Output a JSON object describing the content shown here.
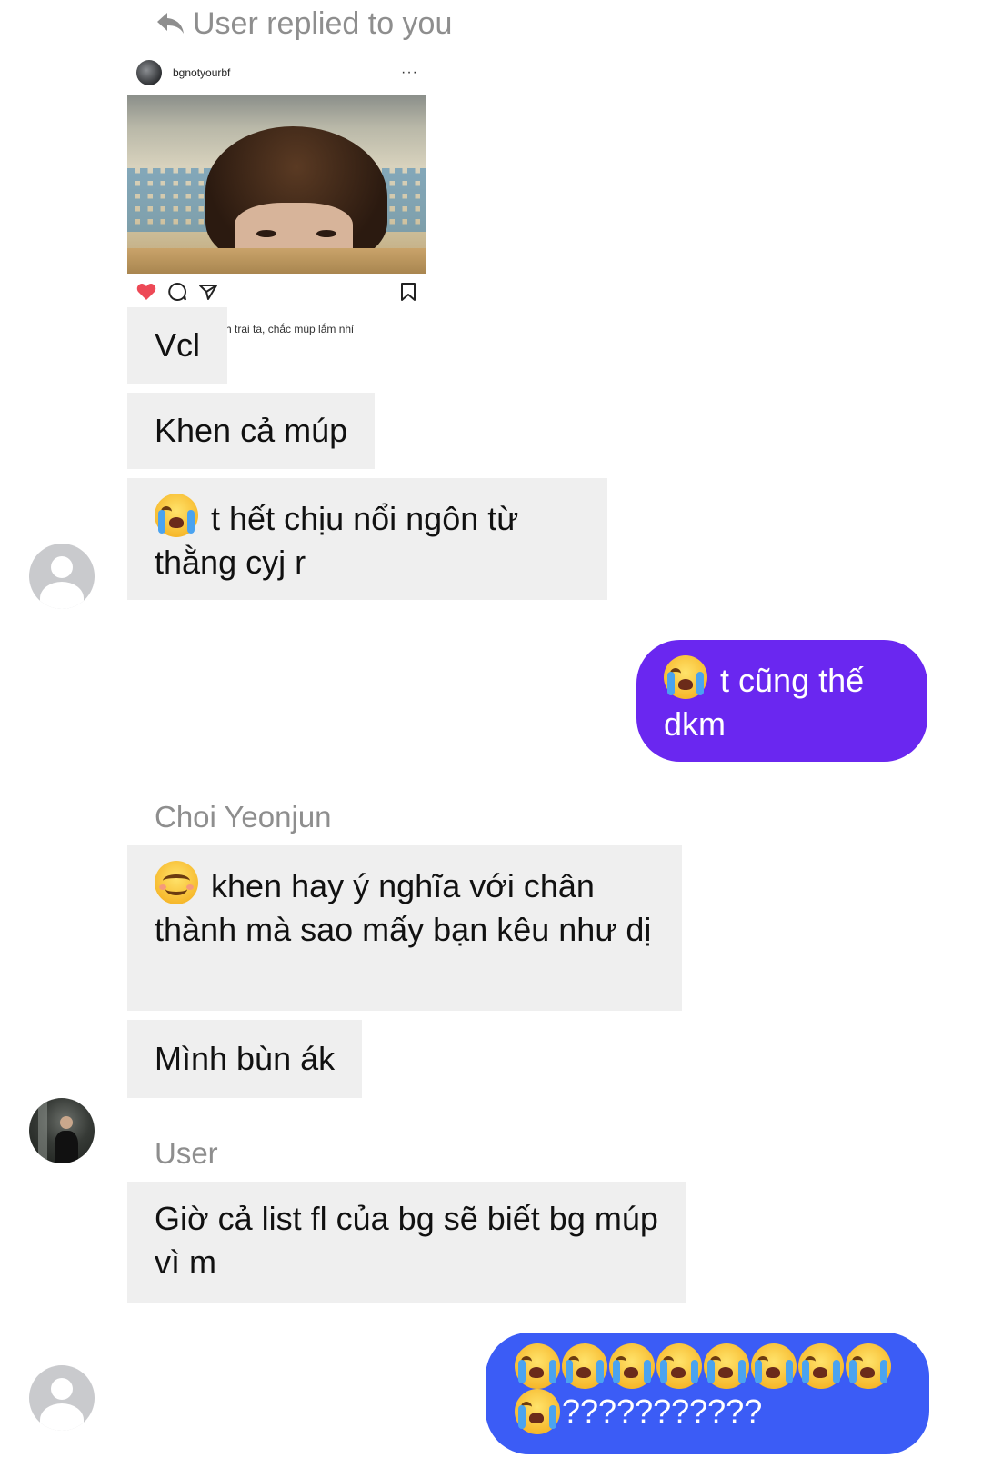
{
  "reply_header": {
    "icon": "reply-arrow-icon",
    "text": "User replied to you"
  },
  "post": {
    "username": "bgnotyourbf",
    "more": "···",
    "caption": "h trai ta, chắc múp lắm nhỉ"
  },
  "messages": [
    {
      "direction": "in",
      "text": "Vcl"
    },
    {
      "direction": "in",
      "text": "Khen cả múp"
    },
    {
      "direction": "in",
      "emoji": "loudly-crying",
      "text": "t hết chịu nổi ngôn từ thằng cyj r"
    },
    {
      "direction": "out",
      "emoji": "loudly-crying",
      "text": "t cũng thế dkm"
    },
    {
      "direction": "in",
      "sender": "Choi Yeonjun",
      "emoji": "smiling-face",
      "text": "khen hay ý nghĩa với chân thành mà sao mấy bạn kêu như dị"
    },
    {
      "direction": "in",
      "text": "Mình bùn ák"
    },
    {
      "direction": "in",
      "sender": "User",
      "text": "Giờ cả list fl của bg sẽ biết bg múp vì m"
    },
    {
      "direction": "out",
      "emoji_count": 9,
      "emoji": "loudly-crying",
      "text": "???????????"
    }
  ],
  "colors": {
    "incoming_bubble": "#efefef",
    "outgoing_purple": "#6a27f0",
    "outgoing_blue": "#3b5cf6",
    "meta_text": "#8e8e8e",
    "like_heart": "#ed4956"
  }
}
